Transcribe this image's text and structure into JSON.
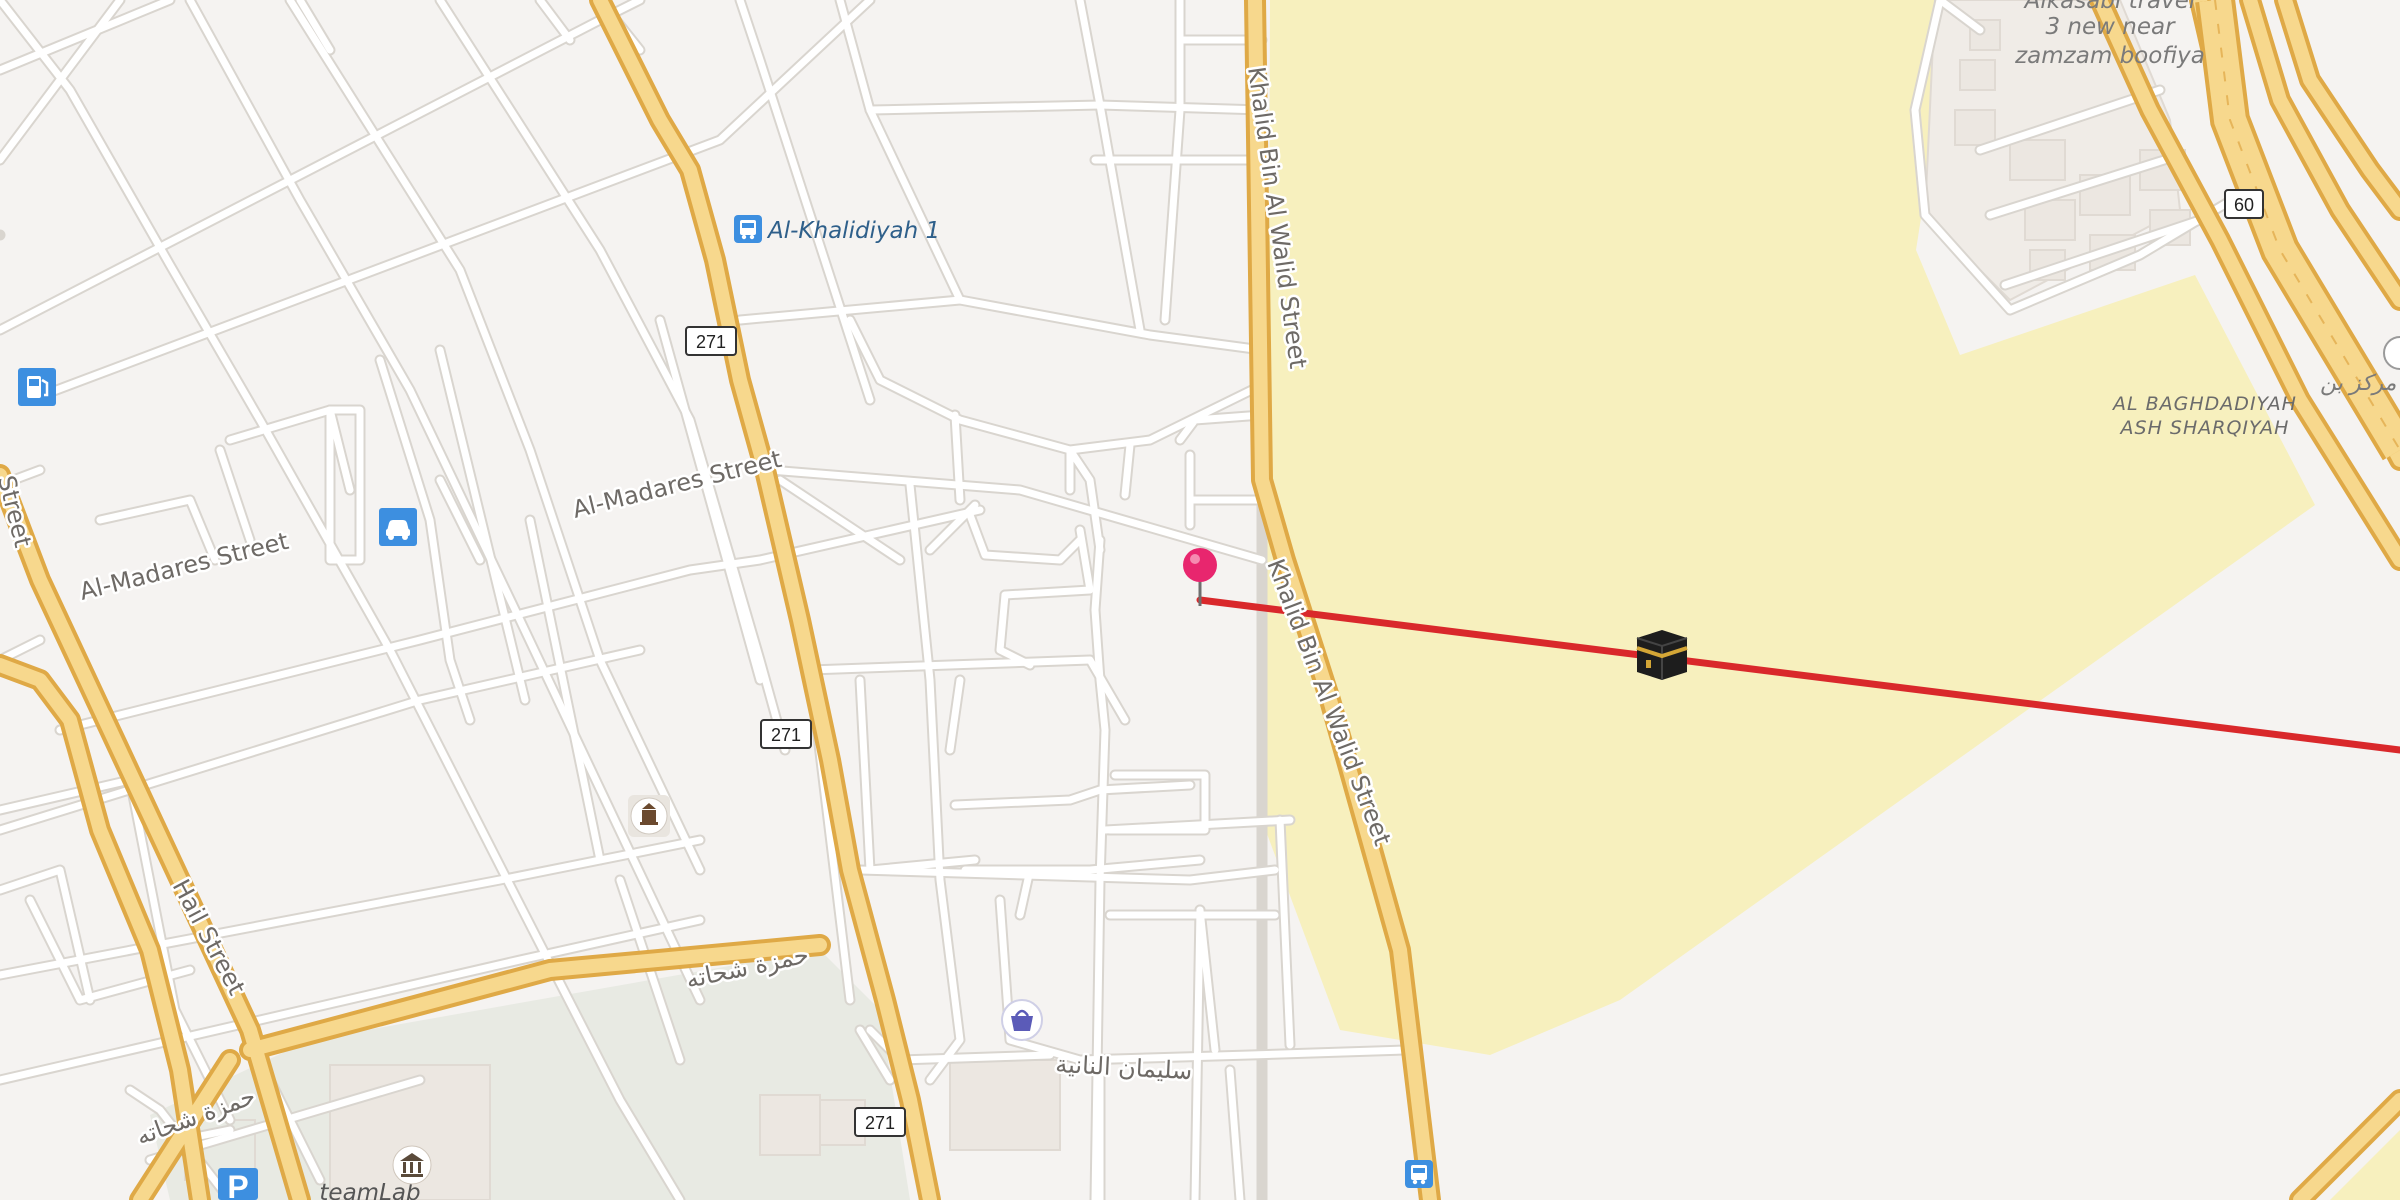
{
  "map": {
    "streets": {
      "khalid_upper": "Khalid Bin Al Walid Street",
      "khalid_lower": "Khalid Bin Al Walid Street",
      "madares_east": "Al-Madares Street",
      "madares_west": "Al-Madares Street",
      "hail": "Hail Street",
      "left_edge_street": "Street",
      "hamza_east": "حمزة شحاته",
      "hamza_west": "حمزة شحاته",
      "sulaiman": "سليمان النانية"
    },
    "places": {
      "bus_stop_khalidiyah": "Al-Khalidiyah 1",
      "travel_agency": [
        "Alkasabi travel",
        "3 new near",
        "zamzam boofiya"
      ],
      "district": [
        "AL BAGHDADIYAH",
        "ASH SHARQIYAH"
      ],
      "teamlab": "teamLab",
      "arabic_center": "مركز بن"
    },
    "route_shields": [
      "271",
      "271",
      "271",
      "60"
    ],
    "icons": {
      "fuel": "fuel-station-icon",
      "car_rental": "car-rental-icon",
      "bus": "bus-stop-icon",
      "museum": "museum-icon",
      "shopping": "shopping-bag-icon",
      "parking": "parking-icon",
      "kaaba": "kaaba-icon",
      "pin": "map-pin-icon"
    },
    "colors": {
      "background": "#f5f3f1",
      "block_fill": "#f0eeec",
      "haram_area": "#f7f0be",
      "park_area": "#e8eae3",
      "highway_fill": "#f7d88d",
      "highway_casing": "#dfa946",
      "road_fill": "#ffffff",
      "qibla_line": "#d9282b",
      "pin": "#e8266e",
      "poi_blue": "#3d8fe0",
      "label_blue": "#2e5f8a"
    }
  }
}
